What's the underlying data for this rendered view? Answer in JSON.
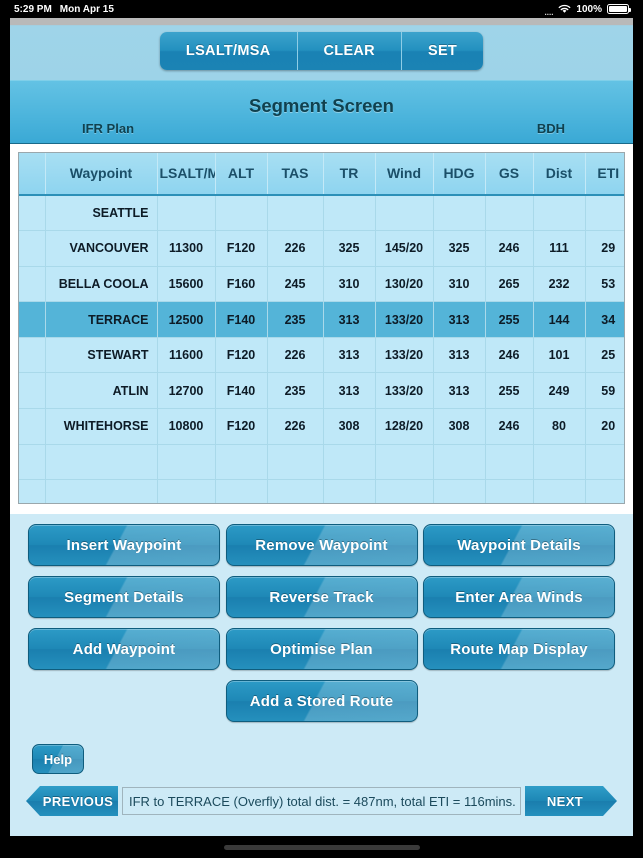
{
  "statusbar": {
    "time": "5:29 PM",
    "date": "Mon Apr 15",
    "dots": "....",
    "battery_pct": "100%",
    "wifi_icon": "wifi-icon",
    "battery_icon": "battery-icon"
  },
  "toolbar": {
    "segments": [
      {
        "label": "LSALT/MSA"
      },
      {
        "label": "CLEAR"
      },
      {
        "label": "SET"
      }
    ]
  },
  "titlebar": {
    "title": "Segment Screen",
    "left_label": "IFR Plan",
    "right_label": "BDH"
  },
  "table": {
    "headers": [
      "",
      "Waypoint",
      "LSALT/MSA",
      "ALT",
      "TAS",
      "TR",
      "Wind",
      "HDG",
      "GS",
      "Dist",
      "ETI"
    ],
    "selected_row_index": 3,
    "rows": [
      {
        "waypoint": "SEATTLE",
        "lsalt": "",
        "alt": "",
        "tas": "",
        "tr": "",
        "wind": "",
        "hdg": "",
        "gs": "",
        "dist": "",
        "eti": ""
      },
      {
        "waypoint": "VANCOUVER",
        "lsalt": "11300",
        "alt": "F120",
        "tas": "226",
        "tr": "325",
        "wind": "145/20",
        "hdg": "325",
        "gs": "246",
        "dist": "111",
        "eti": "29"
      },
      {
        "waypoint": "BELLA COOLA",
        "lsalt": "15600",
        "alt": "F160",
        "tas": "245",
        "tr": "310",
        "wind": "130/20",
        "hdg": "310",
        "gs": "265",
        "dist": "232",
        "eti": "53"
      },
      {
        "waypoint": "TERRACE",
        "lsalt": "12500",
        "alt": "F140",
        "tas": "235",
        "tr": "313",
        "wind": "133/20",
        "hdg": "313",
        "gs": "255",
        "dist": "144",
        "eti": "34"
      },
      {
        "waypoint": "STEWART",
        "lsalt": "11600",
        "alt": "F120",
        "tas": "226",
        "tr": "313",
        "wind": "133/20",
        "hdg": "313",
        "gs": "246",
        "dist": "101",
        "eti": "25"
      },
      {
        "waypoint": "ATLIN",
        "lsalt": "12700",
        "alt": "F140",
        "tas": "235",
        "tr": "313",
        "wind": "133/20",
        "hdg": "313",
        "gs": "255",
        "dist": "249",
        "eti": "59"
      },
      {
        "waypoint": "WHITEHORSE",
        "lsalt": "10800",
        "alt": "F120",
        "tas": "226",
        "tr": "308",
        "wind": "128/20",
        "hdg": "308",
        "gs": "246",
        "dist": "80",
        "eti": "20"
      },
      {
        "waypoint": "",
        "lsalt": "",
        "alt": "",
        "tas": "",
        "tr": "",
        "wind": "",
        "hdg": "",
        "gs": "",
        "dist": "",
        "eti": ""
      },
      {
        "waypoint": "",
        "lsalt": "",
        "alt": "",
        "tas": "",
        "tr": "",
        "wind": "",
        "hdg": "",
        "gs": "",
        "dist": "",
        "eti": ""
      }
    ]
  },
  "actions": {
    "rows": [
      [
        {
          "label": "Insert Waypoint"
        },
        {
          "label": "Remove Waypoint"
        },
        {
          "label": "Waypoint Details"
        }
      ],
      [
        {
          "label": "Segment Details"
        },
        {
          "label": "Reverse Track"
        },
        {
          "label": "Enter Area Winds"
        }
      ],
      [
        {
          "label": "Add Waypoint"
        },
        {
          "label": "Optimise Plan"
        },
        {
          "label": "Route Map Display"
        }
      ],
      [
        {
          "label": "Add a Stored Route"
        }
      ]
    ]
  },
  "help": {
    "label": "Help"
  },
  "nav": {
    "previous_label": "PREVIOUS",
    "next_label": "NEXT",
    "status_text": "IFR to TERRACE (Overfly) total dist. = 487nm, total ETI = 116mins."
  },
  "colors": {
    "accent": "#1e88b6",
    "title_bar": "#4fb6dd",
    "table_cell": "#bfe8f8",
    "table_selected": "#54b4d8",
    "page_bg": "#cdeaf6"
  }
}
